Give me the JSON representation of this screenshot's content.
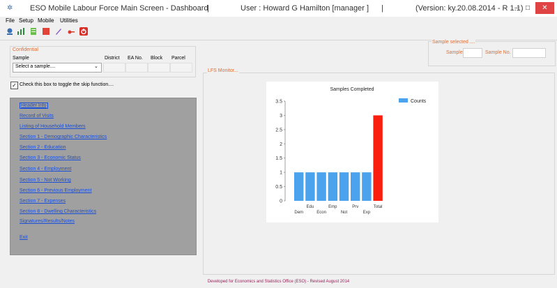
{
  "window": {
    "title": "ESO Mobile Labour Force Main Screen - Dashboard",
    "separator": "|",
    "user": "User : Howard G Hamilton [manager ]",
    "version": "(Version: ky.20.08.2014 - R 1.1)",
    "min_glyph": "–",
    "max_glyph": "□",
    "close_glyph": "✕",
    "close_color": "#e04343"
  },
  "menu": [
    "File",
    "Setup",
    "Mobile",
    "Utilities"
  ],
  "toolbar_icons": [
    "home-icon",
    "chart-icon",
    "document-icon",
    "grid-icon",
    "edit-icon",
    "key-icon",
    "power-icon"
  ],
  "confidential": {
    "label": "Confidential",
    "sample_label": "Sample",
    "select_placeholder": "Select a sample....",
    "columns": [
      "District",
      "EA No.",
      "Block",
      "Parcel"
    ]
  },
  "skip_toggle": {
    "label": "Check this box to toggle the skip function....",
    "checked": true
  },
  "nav": {
    "items": [
      "Header Info",
      "Record of Visits",
      "Listing of Household Members",
      "Section 1 - Demographic Characteristics",
      "Section 2 - Education",
      "Section 3 - Economic Status",
      "Section 4 - Employment",
      "Section 5 - Not Working",
      "Section 6 - Previous Employment",
      "Section 7 - Expenses",
      "Section 8 - Dwelling Characteristics",
      "Signatures/Results/Notes"
    ],
    "exit": "Exit"
  },
  "sample_selected": {
    "label": "Sample selected ....",
    "id_label": "Sample ID",
    "no_label": "Sample No."
  },
  "monitor_label": "LFS Monitor...",
  "chart_data": {
    "type": "bar",
    "title": "Samples Completed",
    "categories": [
      "Dem",
      "Edu",
      "Econ",
      "Emp",
      "Not",
      "Prv",
      "Exp",
      "Total"
    ],
    "series": [
      {
        "name": "Counts",
        "values": [
          1,
          1,
          1,
          1,
          1,
          1,
          1,
          3
        ]
      }
    ],
    "bar_colors": [
      "#4aa3ec",
      "#4aa3ec",
      "#4aa3ec",
      "#4aa3ec",
      "#4aa3ec",
      "#4aa3ec",
      "#4aa3ec",
      "#fa1e0e"
    ],
    "ylim": [
      0,
      3.5
    ],
    "yticks": [
      "0",
      "0.5",
      "1",
      "1.5",
      "2",
      "2.5",
      "3",
      "3.5"
    ],
    "legend_position": "top-right",
    "grid": false
  },
  "footer": "Developed for Economics and Statistics Office (ESO) - Revised August 2014"
}
